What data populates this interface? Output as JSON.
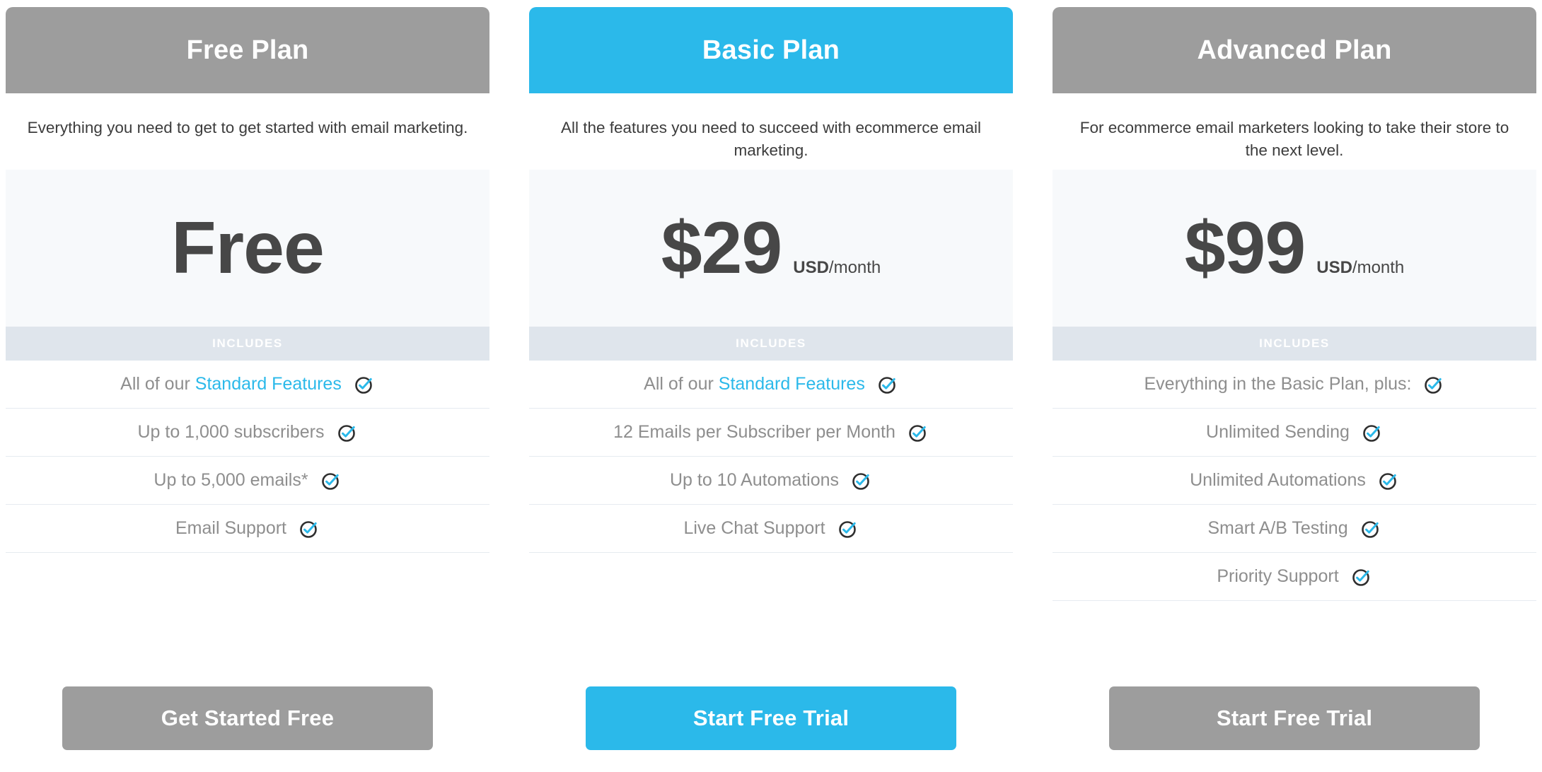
{
  "theme": {
    "grey": "#9d9d9d",
    "blue": "#2bb9ea",
    "price_panel_bg": "#f7f9fb",
    "includes_band_bg": "#dfe5ec",
    "divider": "#e6ebf0",
    "price_text": "#474747",
    "feature_text": "#8e8e8e",
    "tagline_text": "#3c3c3c"
  },
  "includes_label": "INCLUDES",
  "check_icon_name": "check-circle-icon",
  "plans": [
    {
      "id": "free",
      "title": "Free Plan",
      "tagline": "Everything you need to get to get started with email marketing.",
      "accent": "#9d9d9d",
      "price_amount": "Free",
      "price_currency": "",
      "price_period": "",
      "has_price_unit": false,
      "features": [
        {
          "prefix": "All of our ",
          "link": "Standard Features",
          "suffix": ""
        },
        {
          "prefix": "Up to 1,000 subscribers",
          "link": "",
          "suffix": ""
        },
        {
          "prefix": "Up to 5,000 emails*",
          "link": "",
          "suffix": ""
        },
        {
          "prefix": "Email Support",
          "link": "",
          "suffix": ""
        }
      ],
      "cta_label": "Get Started Free"
    },
    {
      "id": "basic",
      "title": "Basic Plan",
      "tagline": "All the features you need to succeed with ecommerce email marketing.",
      "accent": "#2bb9ea",
      "price_amount": "$29",
      "price_currency": "USD",
      "price_period": "/month",
      "has_price_unit": true,
      "features": [
        {
          "prefix": "All of our ",
          "link": "Standard Features",
          "suffix": ""
        },
        {
          "prefix": "12 Emails per Subscriber per Month",
          "link": "",
          "suffix": ""
        },
        {
          "prefix": "Up to 10 Automations",
          "link": "",
          "suffix": ""
        },
        {
          "prefix": "Live Chat Support",
          "link": "",
          "suffix": ""
        }
      ],
      "cta_label": "Start Free Trial"
    },
    {
      "id": "advanced",
      "title": "Advanced Plan",
      "tagline": "For ecommerce email marketers looking to take their store to the next level.",
      "accent": "#9d9d9d",
      "price_amount": "$99",
      "price_currency": "USD",
      "price_period": "/month",
      "has_price_unit": true,
      "features": [
        {
          "prefix": "Everything in the Basic Plan, plus:",
          "link": "",
          "suffix": ""
        },
        {
          "prefix": "Unlimited Sending",
          "link": "",
          "suffix": ""
        },
        {
          "prefix": "Unlimited Automations",
          "link": "",
          "suffix": ""
        },
        {
          "prefix": "Smart A/B Testing",
          "link": "",
          "suffix": ""
        },
        {
          "prefix": "Priority Support",
          "link": "",
          "suffix": ""
        }
      ],
      "cta_label": "Start Free Trial"
    }
  ]
}
